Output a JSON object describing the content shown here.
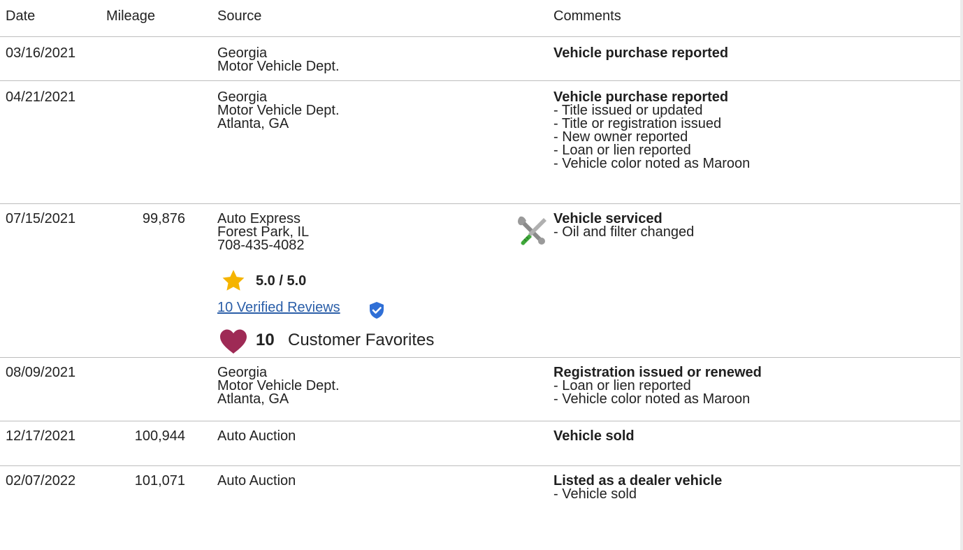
{
  "headers": {
    "date": "Date",
    "mileage": "Mileage",
    "source": "Source",
    "comments": "Comments"
  },
  "rows": [
    {
      "date": "03/16/2021",
      "mileage": "",
      "source": [
        "Georgia",
        "Motor Vehicle Dept."
      ],
      "comment_title": "Vehicle purchase reported",
      "comment_lines": []
    },
    {
      "date": "04/21/2021",
      "mileage": "",
      "source": [
        "Georgia",
        "Motor Vehicle Dept.",
        "Atlanta, GA"
      ],
      "comment_title": "Vehicle purchase reported",
      "comment_lines": [
        "- Title issued or updated",
        "- Title or registration issued",
        "- New owner reported",
        "- Loan or lien reported",
        "- Vehicle color noted as Maroon"
      ]
    },
    {
      "date": "07/15/2021",
      "mileage": "99,876",
      "source": [
        "Auto Express",
        "Forest Park, IL",
        "708-435-4082"
      ],
      "rating": "5.0 / 5.0",
      "reviews_link": "10 Verified Reviews",
      "favorites_count": "10",
      "favorites_label": "Customer Favorites",
      "comment_icon": "wrench-screwdriver-icon",
      "comment_title": "Vehicle serviced",
      "comment_lines": [
        "- Oil and filter changed"
      ]
    },
    {
      "date": "08/09/2021",
      "mileage": "",
      "source": [
        "Georgia",
        "Motor Vehicle Dept.",
        "Atlanta, GA"
      ],
      "comment_title": "Registration issued or renewed",
      "comment_lines": [
        "- Loan or lien reported",
        "- Vehicle color noted as Maroon"
      ]
    },
    {
      "date": "12/17/2021",
      "mileage": "100,944",
      "source": [
        "Auto Auction"
      ],
      "comment_title": "Vehicle sold",
      "comment_lines": []
    },
    {
      "date": "02/07/2022",
      "mileage": "101,071",
      "source": [
        "Auto Auction"
      ],
      "comment_title": "Listed as a dealer vehicle",
      "comment_lines": [
        "- Vehicle sold"
      ]
    }
  ],
  "colors": {
    "text": "#222222",
    "divider": "#bdbdbd",
    "link": "#2a5ea8",
    "star": "#f5b400",
    "heart": "#9e2a55",
    "shield": "#2f6fd6"
  }
}
